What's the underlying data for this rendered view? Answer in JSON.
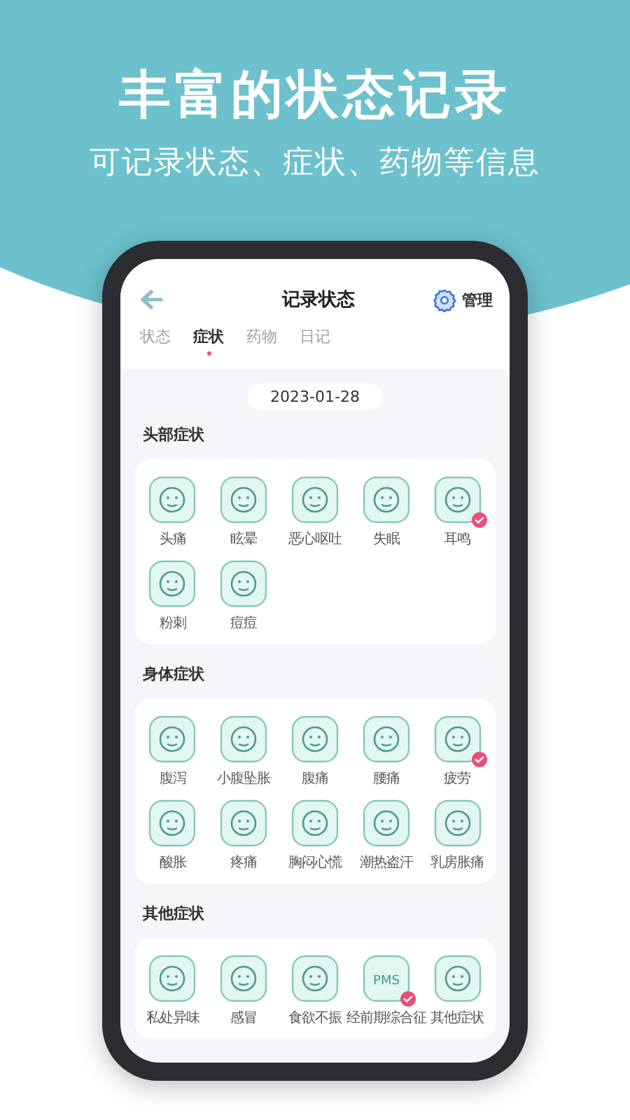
{
  "headline": "丰富的状态记录",
  "subheadline": "可记录状态、症状、药物等信息",
  "screen": {
    "title": "记录状态",
    "manage_label": "管理",
    "tabs": [
      {
        "label": "状态",
        "selected": false
      },
      {
        "label": "症状",
        "selected": true
      },
      {
        "label": "药物",
        "selected": false
      },
      {
        "label": "日记",
        "selected": false
      }
    ],
    "date": "2023-01-28",
    "sections": [
      {
        "title": "头部症状",
        "items": [
          {
            "label": "头痛",
            "selected": false
          },
          {
            "label": "眩晕",
            "selected": false
          },
          {
            "label": "恶心呕吐",
            "selected": false
          },
          {
            "label": "失眠",
            "selected": false
          },
          {
            "label": "耳鸣",
            "selected": true
          },
          {
            "label": "粉刺",
            "selected": false
          },
          {
            "label": "痘痘",
            "selected": false
          }
        ]
      },
      {
        "title": "身体症状",
        "items": [
          {
            "label": "腹泻",
            "selected": false
          },
          {
            "label": "小腹坠胀",
            "selected": false
          },
          {
            "label": "腹痛",
            "selected": false
          },
          {
            "label": "腰痛",
            "selected": false
          },
          {
            "label": "疲劳",
            "selected": true
          },
          {
            "label": "酸胀",
            "selected": false
          },
          {
            "label": "疼痛",
            "selected": false
          },
          {
            "label": "胸闷心慌",
            "selected": false
          },
          {
            "label": "潮热盗汗",
            "selected": false
          },
          {
            "label": "乳房胀痛",
            "selected": false
          }
        ]
      },
      {
        "title": "其他症状",
        "items": [
          {
            "label": "私处异味",
            "selected": false
          },
          {
            "label": "感冒",
            "selected": false
          },
          {
            "label": "食欲不振",
            "selected": false
          },
          {
            "label": "经前期综合征",
            "selected": true,
            "icon_text": "PMS"
          },
          {
            "label": "其他症状",
            "selected": false
          }
        ]
      }
    ]
  }
}
